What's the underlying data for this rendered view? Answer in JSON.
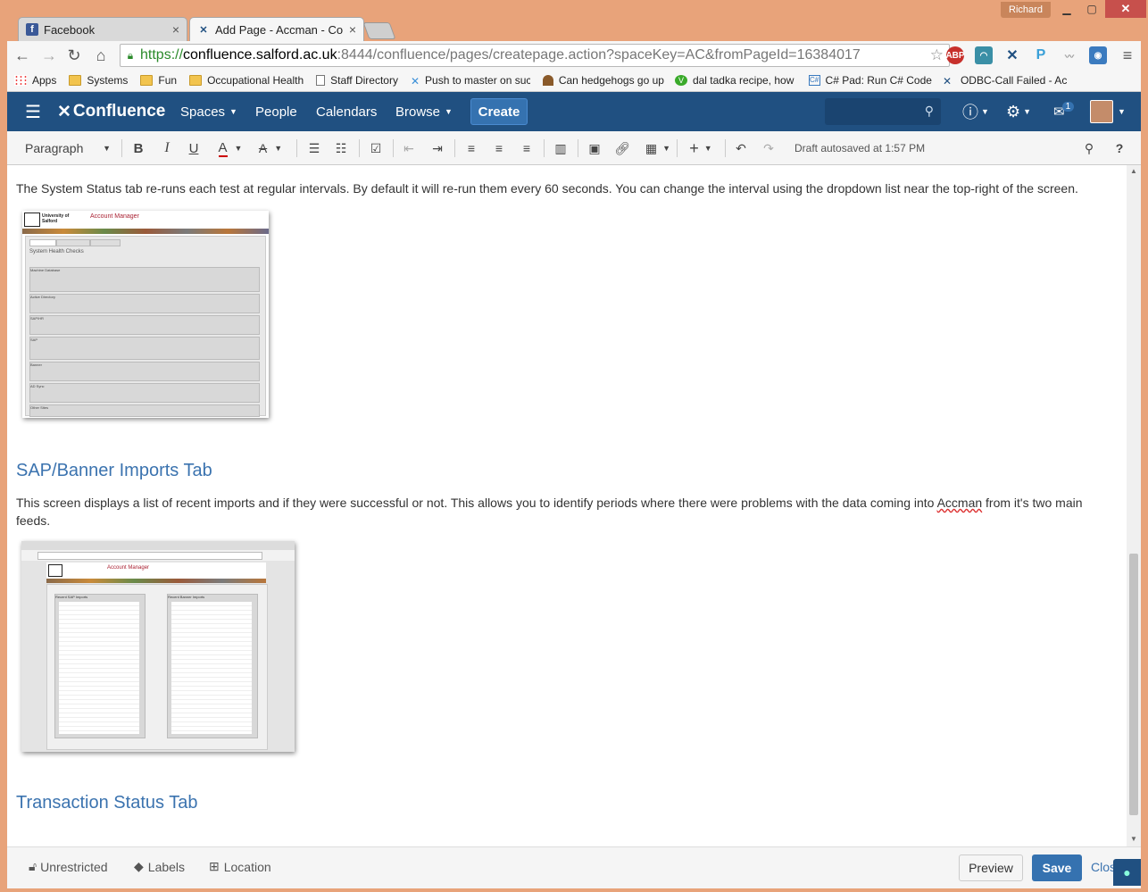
{
  "browser": {
    "user": "Richard",
    "tabs": [
      {
        "title": "Facebook",
        "icon": "facebook-icon"
      },
      {
        "title": "Add Page - Accman - Con",
        "icon": "confluence-icon"
      }
    ],
    "url": {
      "scheme": "https://",
      "host": "confluence.salford.ac.uk",
      "path": ":8444/confluence/pages/createpage.action?spaceKey=AC&fromPageId=16384017"
    },
    "extensions": [
      "ABP",
      "P"
    ],
    "bookmarks": [
      {
        "label": "Apps",
        "icon": "apps-grid-icon"
      },
      {
        "label": "Systems",
        "icon": "folder-icon"
      },
      {
        "label": "Fun",
        "icon": "folder-icon"
      },
      {
        "label": "Occupational Health",
        "icon": "folder-icon"
      },
      {
        "label": "Staff Directory",
        "icon": "page-icon"
      },
      {
        "label": "Push to master on suc",
        "icon": "jenkins-icon"
      },
      {
        "label": "Can hedgehogs go up",
        "icon": "hedgehog-icon"
      },
      {
        "label": "dal tadka recipe, how",
        "icon": "v-icon"
      },
      {
        "label": "C# Pad: Run C# Code",
        "icon": "csharp-icon"
      },
      {
        "label": "ODBC-Call Failed - Ac",
        "icon": "confluence-icon"
      }
    ]
  },
  "header": {
    "logo": "Confluence",
    "nav": [
      "Spaces",
      "People",
      "Calendars",
      "Browse"
    ],
    "create": "Create",
    "notification_count": "1"
  },
  "editor_toolbar": {
    "paragraph": "Paragraph",
    "bold": "B",
    "italic": "I",
    "underline": "U",
    "text_color": "A",
    "draft_status": "Draft autosaved at 1:57 PM",
    "help": "?"
  },
  "content": {
    "para1": "The System Status tab re-runs each test at regular intervals. By default it will re-run them every 60 seconds. You can change the interval using the dropdown list near the top-right of the screen.",
    "heading1": "SAP/Banner Imports Tab",
    "para2_line1_a": "This screen displays a list of recent imports and if they were successful or not. This allows you to identify periods where there were problems with the data coming into ",
    "para2_accman": "Accman",
    "para2_line1_b": " from it's two main",
    "para2_line2": "feeds.",
    "heading2": "Transaction Status Tab",
    "thumb1": {
      "title": "Account Manager",
      "section": "System Health Checks",
      "groups": [
        "Machine Database",
        "Active Directory",
        "SAP/HR",
        "SAP",
        "Banner",
        "AD Sync",
        "Other Sites"
      ]
    },
    "thumb2": {
      "title": "Account Manager",
      "left_table": "Recent SAP Imports",
      "right_table": "Recent Banner Imports"
    }
  },
  "footer": {
    "restrictions": "Unrestricted",
    "labels": "Labels",
    "location": "Location",
    "preview": "Preview",
    "save": "Save",
    "close": "Close"
  },
  "colors": {
    "brand": "#205081",
    "create": "#3572b0",
    "heading": "#3b73af",
    "frame": "#e8a37a"
  }
}
